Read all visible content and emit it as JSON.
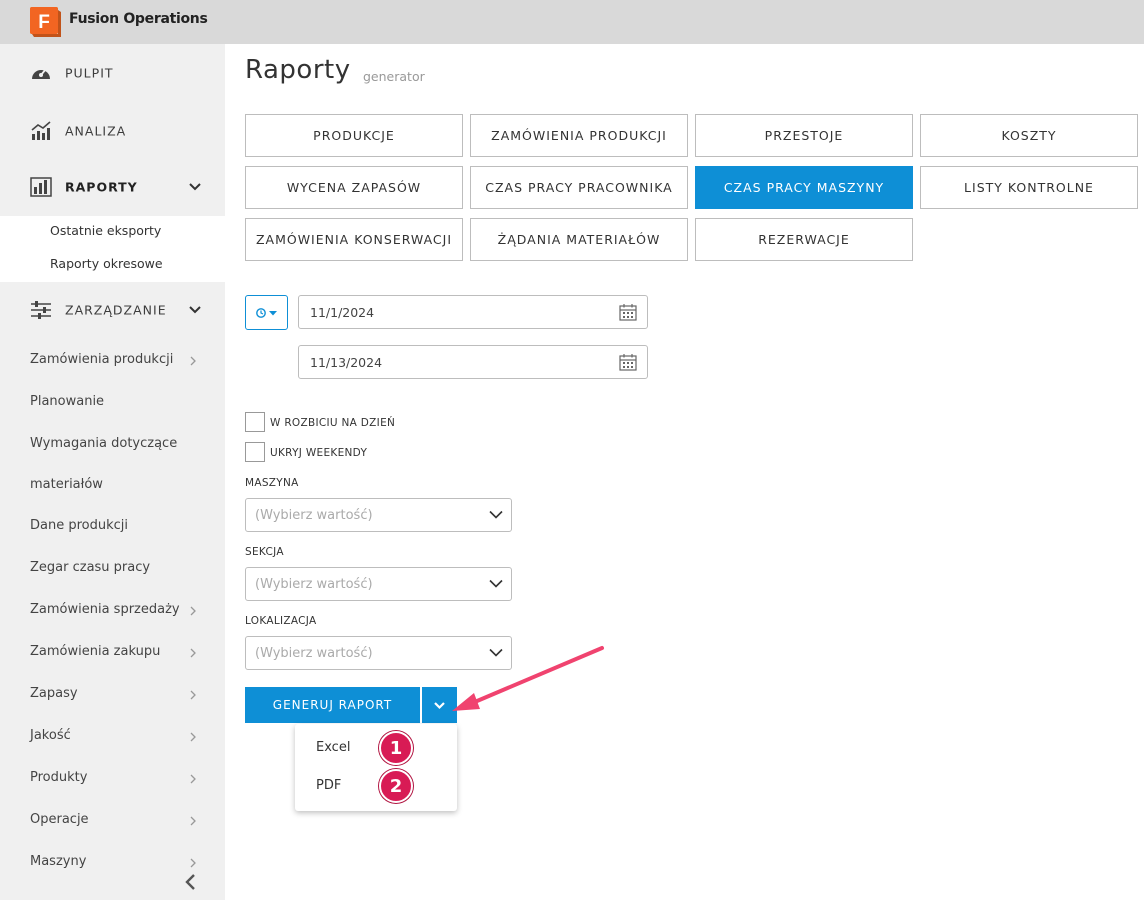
{
  "app": {
    "title": "Fusion Operations",
    "logo_letter": "F",
    "brand_color": "#f26522"
  },
  "sidebar": {
    "main": [
      {
        "label": "PULPIT",
        "icon": "dashboard-icon"
      },
      {
        "label": "ANALIZA",
        "icon": "analytics-chart-icon"
      },
      {
        "label": "RAPORTY",
        "icon": "report-bars-icon"
      },
      {
        "label": "ZARZĄDZANIE",
        "icon": "sliders-icon"
      }
    ],
    "report_sub": [
      "Ostatnie eksporty",
      "Raporty okresowe"
    ],
    "management_items": [
      "Zamówienia produkcji",
      "Planowanie",
      "Wymagania dotyczące",
      "materiałów",
      "Dane produkcji",
      "Zegar czasu pracy",
      "Zamówienia sprzedaży",
      "Zamówienia zakupu",
      "Zapasy",
      "Jakość",
      "Produkty",
      "Operacje",
      "Maszyny"
    ]
  },
  "page": {
    "title": "Raporty",
    "subtitle": "generator"
  },
  "report_types": [
    "PRODUKCJE",
    "ZAMÓWIENIA PRODUKCJI",
    "PRZESTOJE",
    "KOSZTY",
    "WYCENA ZAPASÓW",
    "CZAS PRACY PRACOWNIKA",
    "CZAS PRACY MASZYNY",
    "LISTY KONTROLNE",
    "ZAMÓWIENIA KONSERWACJI",
    "ŻĄDANIA MATERIAŁÓW",
    "REZERWACJE"
  ],
  "active_report": "CZAS PRACY MASZYNY",
  "dates": {
    "from": "11/1/2024",
    "to": "11/13/2024"
  },
  "options": {
    "daily_breakdown": "W ROZBICIU NA DZIEŃ",
    "hide_weekends": "UKRYJ WEEKENDY"
  },
  "filters": {
    "machine": {
      "label": "MASZYNA",
      "placeholder": "(Wybierz wartość)"
    },
    "section": {
      "label": "SEKCJA",
      "placeholder": "(Wybierz wartość)"
    },
    "location": {
      "label": "LOKALIZACJA",
      "placeholder": "(Wybierz wartość)"
    }
  },
  "generate": {
    "label": "GENERUJ RAPORT"
  },
  "export_menu": [
    {
      "label": "Excel",
      "badge": "1"
    },
    {
      "label": "PDF",
      "badge": "2"
    }
  ],
  "colors": {
    "accent": "#0e8fd6",
    "annotation": "#f0436f",
    "badge": "#d81b55"
  }
}
